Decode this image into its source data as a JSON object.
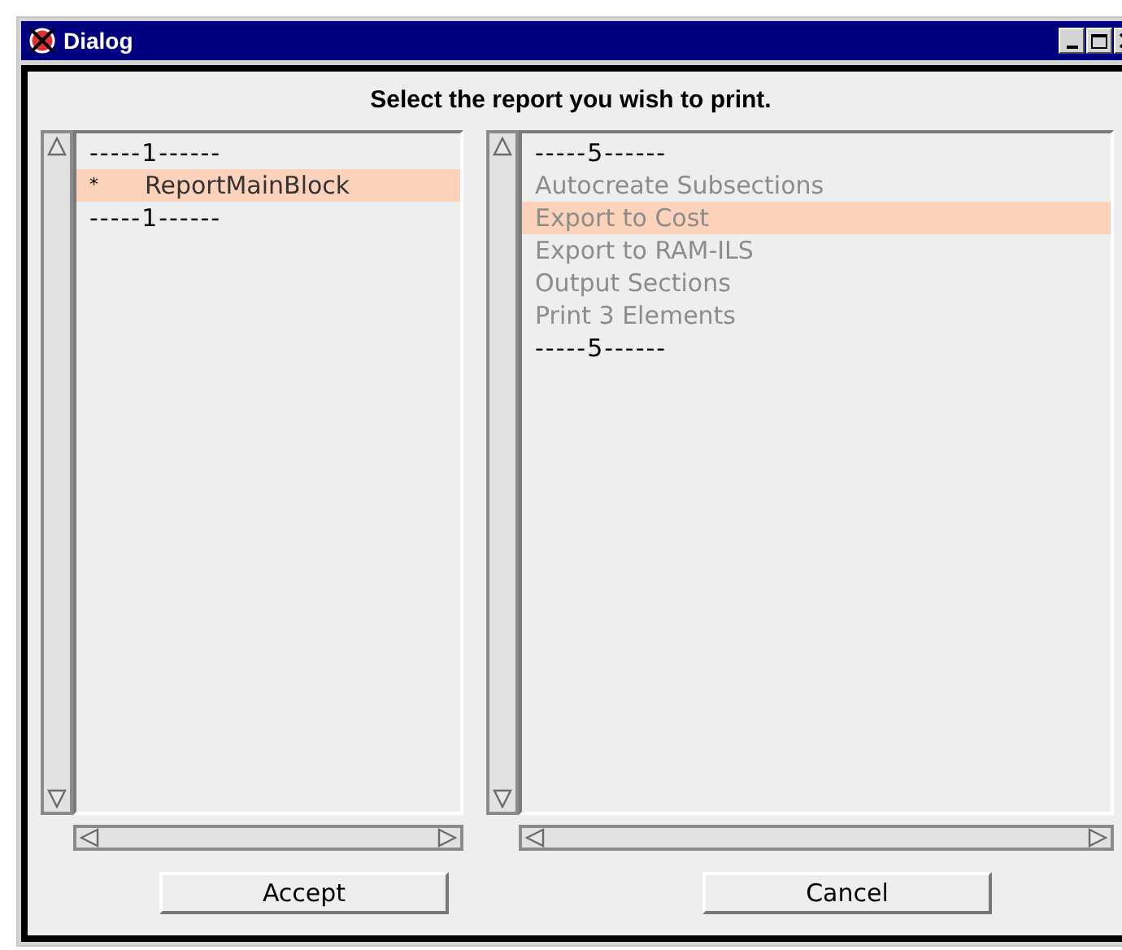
{
  "window": {
    "title": "Dialog"
  },
  "prompt": "Select the report you wish to print.",
  "lists": [
    {
      "items": [
        {
          "kind": "separator",
          "label": "-----1------",
          "selected": false
        },
        {
          "kind": "entry",
          "marker": "*",
          "label": "ReportMainBlock",
          "selected": true,
          "disabled": false
        },
        {
          "kind": "separator",
          "label": "-----1------",
          "selected": false
        }
      ]
    },
    {
      "items": [
        {
          "kind": "separator",
          "label": "-----5------",
          "selected": false
        },
        {
          "kind": "entry",
          "label": "Autocreate Subsections",
          "selected": false,
          "disabled": true
        },
        {
          "kind": "entry",
          "label": "Export to Cost",
          "selected": true,
          "disabled": true
        },
        {
          "kind": "entry",
          "label": "Export to RAM-ILS",
          "selected": false,
          "disabled": true
        },
        {
          "kind": "entry",
          "label": "Output Sections",
          "selected": false,
          "disabled": true
        },
        {
          "kind": "entry",
          "label": "Print 3 Elements",
          "selected": false,
          "disabled": true
        },
        {
          "kind": "separator",
          "label": "-----5------",
          "selected": false
        }
      ]
    }
  ],
  "buttons": [
    "Accept",
    "Cancel"
  ]
}
